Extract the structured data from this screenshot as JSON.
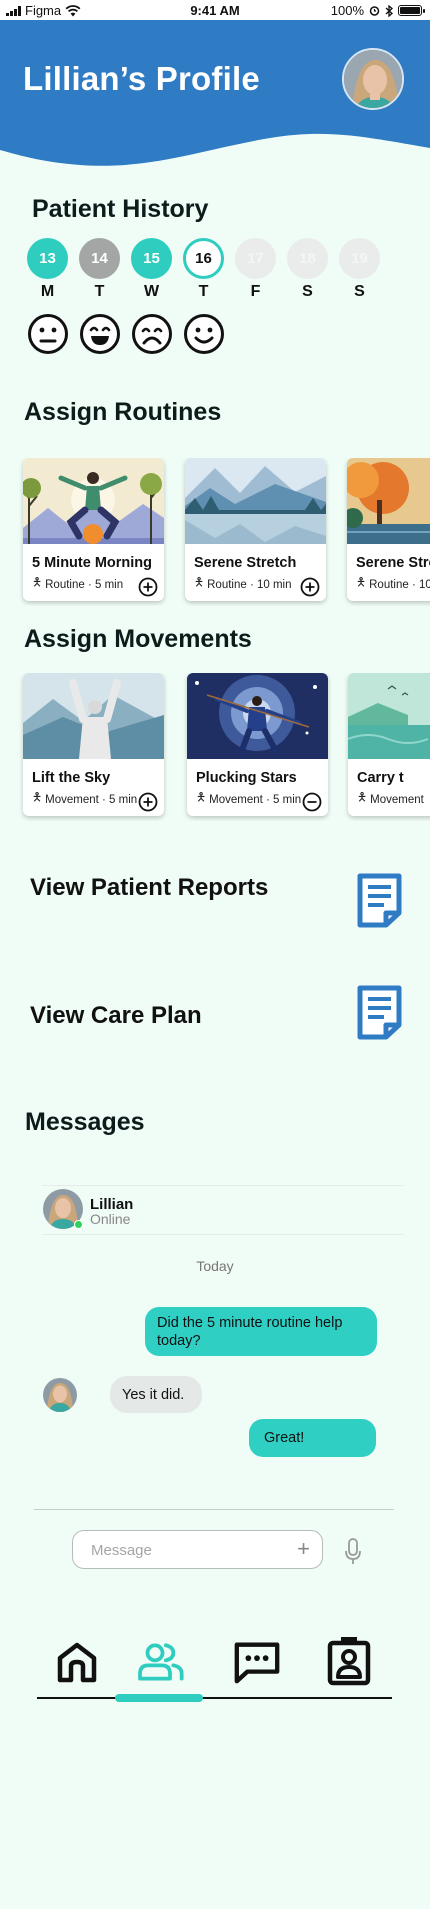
{
  "status_bar": {
    "carrier": "Figma",
    "time": "9:41 AM",
    "battery": "100%"
  },
  "header": {
    "title": "Lillian’s Profile"
  },
  "patient_history": {
    "title": "Patient History",
    "days": [
      {
        "num": "13",
        "letter": "M",
        "state": "teal"
      },
      {
        "num": "14",
        "letter": "T",
        "state": "grey"
      },
      {
        "num": "15",
        "letter": "W",
        "state": "teal"
      },
      {
        "num": "16",
        "letter": "T",
        "state": "ring"
      },
      {
        "num": "17",
        "letter": "F",
        "state": "faint"
      },
      {
        "num": "18",
        "letter": "S",
        "state": "faint"
      },
      {
        "num": "19",
        "letter": "S",
        "state": "faint"
      }
    ],
    "moods": [
      "neutral-face-icon",
      "happy-face-icon",
      "sad-face-icon",
      "smile-face-icon"
    ]
  },
  "routines": {
    "title": "Assign Routines",
    "cards": [
      {
        "title": "5 Minute Morning",
        "meta": "Routine · 5 min",
        "action": "add"
      },
      {
        "title": "Serene Stretch",
        "meta": "Routine · 10 min",
        "action": "add"
      },
      {
        "title": "Serene Stre",
        "meta": "Routine · 10",
        "action": "add"
      }
    ]
  },
  "movements": {
    "title": "Assign Movements",
    "cards": [
      {
        "title": "Lift the Sky",
        "meta": "Movement · 5 min",
        "action": "add"
      },
      {
        "title": "Plucking Stars",
        "meta": "Movement · 5 min",
        "action": "remove"
      },
      {
        "title": "Carry t",
        "meta": "Movement",
        "action": "add"
      }
    ]
  },
  "actions": {
    "reports": "View Patient Reports",
    "care_plan": "View Care Plan"
  },
  "messages": {
    "title": "Messages",
    "contact_name": "Lillian",
    "contact_status": "Online",
    "day_label": "Today",
    "thread": [
      {
        "from": "me",
        "text": "Did the 5 minute routine help today?"
      },
      {
        "from": "them",
        "text": "Yes it did."
      },
      {
        "from": "me",
        "text": "Great!"
      }
    ],
    "input_placeholder": "Message"
  },
  "colors": {
    "brand_blue": "#2f7bc4",
    "accent_teal": "#2fcdc0",
    "background": "#f0fcf6"
  },
  "nav": {
    "items": [
      "home-icon",
      "patients-icon",
      "chat-icon",
      "profile-badge-icon"
    ],
    "active": "patients-icon"
  }
}
